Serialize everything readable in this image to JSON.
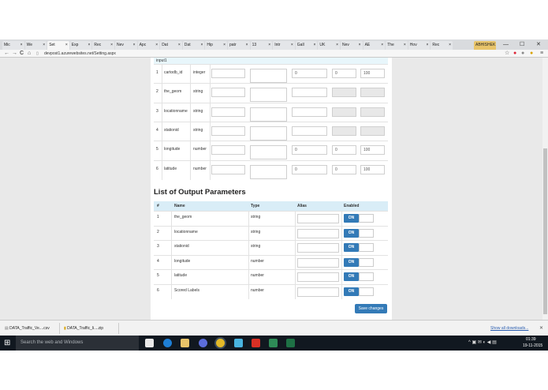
{
  "browser": {
    "tabs": [
      "Mic",
      "We",
      "Set",
      "Exp",
      "Rec",
      "Nev",
      "Apc",
      "Dat",
      "Dat",
      "Hip",
      "patr",
      "13",
      "Intr",
      "Gall",
      "UK",
      "Nev",
      "AE",
      "The",
      "Hov",
      "Rec"
    ],
    "active_tab_index": 2,
    "profile_tab": "ABHISHEK",
    "url": "devpost1.azurewebsites.net/Setting.aspx",
    "controls": {
      "back": "←",
      "forward": "→",
      "reload": "C",
      "home": "⌂",
      "star": "☆",
      "menu": "≡",
      "minimize": "—",
      "maximize": "☐",
      "close": "✕"
    }
  },
  "inputs_section": {
    "top_label": "input1",
    "rows": [
      {
        "num": "1",
        "name": "cartodb_id",
        "type": "integer",
        "val_a": "0",
        "val_b": "0",
        "val_c": "100",
        "disabled": false
      },
      {
        "num": "2",
        "name": "the_geom",
        "type": "string",
        "val_a": "",
        "val_b": "",
        "val_c": "",
        "disabled": true
      },
      {
        "num": "3",
        "name": "locationname",
        "type": "string",
        "val_a": "",
        "val_b": "",
        "val_c": "",
        "disabled": true
      },
      {
        "num": "4",
        "name": "stationid",
        "type": "string",
        "val_a": "",
        "val_b": "",
        "val_c": "",
        "disabled": true
      },
      {
        "num": "5",
        "name": "longitude",
        "type": "number",
        "val_a": "0",
        "val_b": "0",
        "val_c": "100",
        "disabled": false
      },
      {
        "num": "6",
        "name": "latitude",
        "type": "number",
        "val_a": "0",
        "val_b": "0",
        "val_c": "100",
        "disabled": false
      }
    ]
  },
  "outputs_section": {
    "title": "List of Output Parameters",
    "headers": {
      "num": "#",
      "name": "Name",
      "type": "Type",
      "alias": "Alias",
      "enabled": "Enabled"
    },
    "rows": [
      {
        "num": "1",
        "name": "the_geom",
        "type": "string",
        "toggle": "ON"
      },
      {
        "num": "2",
        "name": "locationname",
        "type": "string",
        "toggle": "ON"
      },
      {
        "num": "3",
        "name": "stationid",
        "type": "string",
        "toggle": "ON"
      },
      {
        "num": "4",
        "name": "longitude",
        "type": "number",
        "toggle": "ON"
      },
      {
        "num": "5",
        "name": "latitude",
        "type": "number",
        "toggle": "ON"
      },
      {
        "num": "6",
        "name": "Scored Labels",
        "type": "number",
        "toggle": "ON"
      }
    ],
    "save_label": "Save changes"
  },
  "downloads": {
    "items": [
      "DATA_Traffic_Ve....csv",
      "DATA_Traffic_li....zip"
    ],
    "show_all": "Show all downloads...",
    "close": "✕"
  },
  "taskbar": {
    "search_placeholder": "Search the web and Windows",
    "time": "01:39",
    "date": "19-11-2015"
  },
  "colors": {
    "accent": "#337ab7",
    "table_header": "#d9edf7"
  }
}
